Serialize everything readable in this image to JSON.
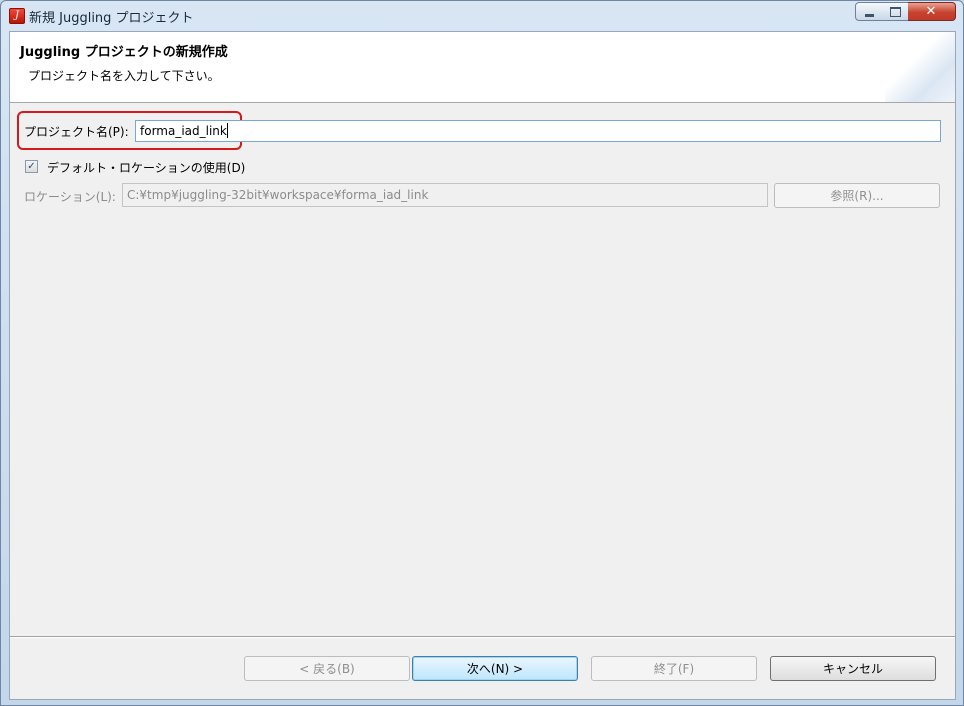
{
  "window": {
    "title": "新規 Juggling プロジェクト",
    "close_glyph": "✕"
  },
  "header": {
    "title": "Juggling プロジェクトの新規作成",
    "description": "プロジェクト名を入力して下さい。"
  },
  "form": {
    "project_name_label": "プロジェクト名(P):",
    "project_name_value": "forma_iad_link",
    "use_default_label": "デフォルト・ロケーションの使用(D)",
    "use_default_checked": true,
    "check_glyph": "✓",
    "location_label": "ロケーション(L):",
    "location_value": "C:¥tmp¥juggling-32bit¥workspace¥forma_iad_link",
    "browse_label": "参照(R)..."
  },
  "buttons": {
    "back": "< 戻る(B)",
    "next": "次へ(N) >",
    "finish": "終了(F)",
    "cancel": "キャンセル"
  },
  "colors": {
    "highlight": "#d61a1a",
    "titlebar": "#c9d9ea",
    "default_button": "#bee6fd"
  },
  "icons": {
    "app": "juggling-app-icon",
    "minimize": "minimize-icon",
    "maximize": "maximize-icon",
    "close": "close-icon",
    "checkbox": "checkmark-icon"
  }
}
